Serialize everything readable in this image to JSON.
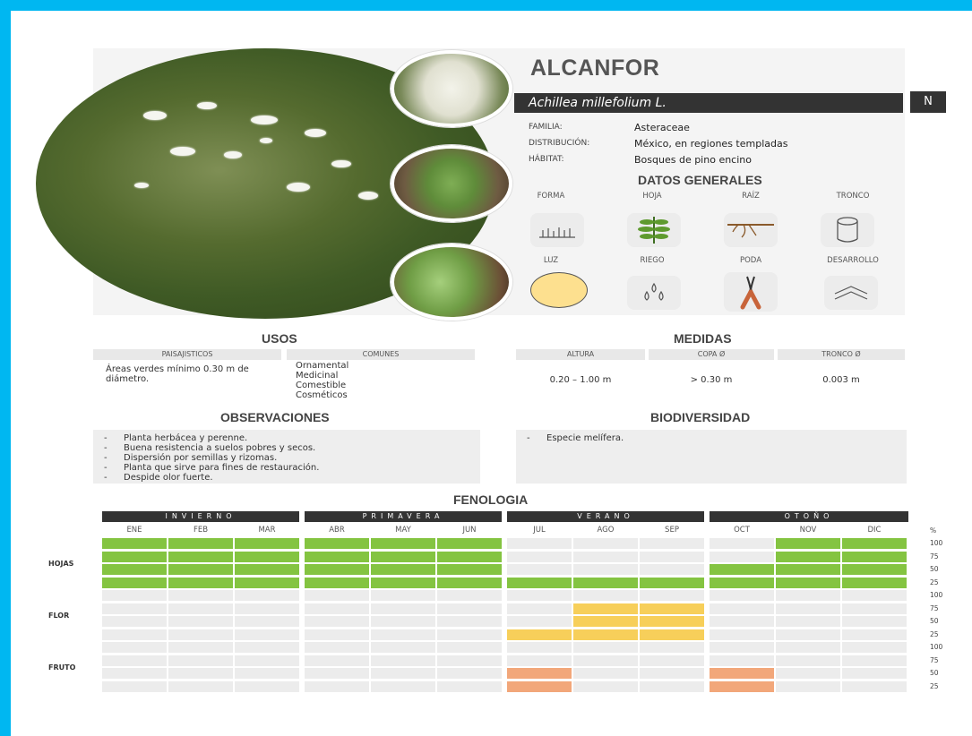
{
  "title": "ALCANFOR",
  "scientific_name": "Achillea millefolium L.",
  "badge": "N",
  "info": [
    {
      "label": "FAMILIA:",
      "value": "Asteraceae"
    },
    {
      "label": "DISTRIBUCIÓN:",
      "value": "México, en regiones templadas"
    },
    {
      "label": "HÁBITAT:",
      "value": "Bosques de pino encino"
    }
  ],
  "datos_generales": {
    "title": "DATOS GENERALES",
    "row1": [
      {
        "label": "FORMA",
        "icon": "grass-form-icon"
      },
      {
        "label": "HOJA",
        "icon": "leaf-icon"
      },
      {
        "label": "RAÍZ",
        "icon": "root-icon"
      },
      {
        "label": "TRONCO",
        "icon": "trunk-icon"
      }
    ],
    "row2": [
      {
        "label": "LUZ",
        "icon": "sun-full-icon"
      },
      {
        "label": "RIEGO",
        "icon": "water-drops-icon"
      },
      {
        "label": "PODA",
        "icon": "pruning-shears-icon"
      },
      {
        "label": "DESARROLLO",
        "icon": "growth-chevron-icon"
      }
    ]
  },
  "usos": {
    "title": "USOS",
    "headers": [
      "PAISAJISTICOS",
      "COMUNES"
    ],
    "paisajisticos": "Áreas verdes mínimo 0.30 m de diámetro.",
    "comunes": [
      "Ornamental",
      "Medicinal",
      "Comestible",
      "Cosméticos"
    ]
  },
  "medidas": {
    "title": "MEDIDAS",
    "headers": [
      "ALTURA",
      "COPA Ø",
      "TRONCO Ø"
    ],
    "values": [
      "0.20 – 1.00 m",
      "> 0.30 m",
      "0.003 m"
    ]
  },
  "observaciones": {
    "title": "OBSERVACIONES",
    "items": [
      "Planta herbácea y perenne.",
      "Buena resistencia a suelos pobres y secos.",
      "Dispersión por semillas y rizomas.",
      "Planta que sirve para fines de restauración.",
      "Despide olor fuerte."
    ]
  },
  "biodiversidad": {
    "title": "BIODIVERSIDAD",
    "items": [
      "Especie melífera."
    ]
  },
  "fenologia": {
    "title": "FENOLOGIA",
    "seasons": [
      "INVIERNO",
      "PRIMAVERA",
      "VERANO",
      "OTOÑO"
    ],
    "months": [
      "ENE",
      "FEB",
      "MAR",
      "ABR",
      "MAY",
      "JUN",
      "JUL",
      "AGO",
      "SEP",
      "OCT",
      "NOV",
      "DIC"
    ],
    "pct_header": "%",
    "levels": [
      "100",
      "75",
      "50",
      "25"
    ],
    "rows": [
      {
        "label": "HOJAS",
        "color": "#84c441",
        "levels": [
          4,
          4,
          4,
          4,
          4,
          4,
          1,
          1,
          1,
          2,
          4,
          4
        ]
      },
      {
        "label": "FLOR",
        "color": "#f7cf5a",
        "levels": [
          0,
          0,
          0,
          0,
          0,
          0,
          1,
          3,
          3,
          0,
          0,
          0
        ]
      },
      {
        "label": "FRUTO",
        "color": "#f2a77a",
        "levels": [
          0,
          0,
          0,
          0,
          0,
          0,
          2,
          0,
          0,
          2,
          0,
          0
        ]
      }
    ],
    "empty_color": "#ececec"
  }
}
